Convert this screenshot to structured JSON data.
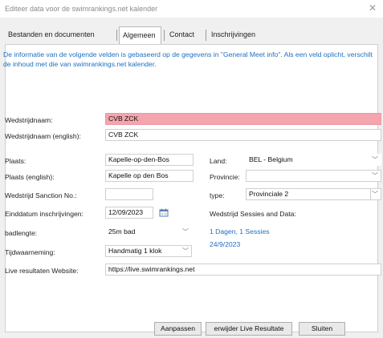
{
  "window": {
    "title": "Editeer data voor de swimrankings.net kalender",
    "close_glyph": "✕"
  },
  "tabs": [
    {
      "label": "Bestanden en documenten",
      "active": false
    },
    {
      "label": "Algemeen",
      "active": true
    },
    {
      "label": "Contact",
      "active": false
    },
    {
      "label": "Inschrijvingen",
      "active": false
    }
  ],
  "info_text": "De informatie van de volgende velden is gebaseerd op de gegevens in \"General Meet info\". Als een veld oplicht, verschilt de inhoud met die van swimrankings.net kalender.",
  "form": {
    "meet_name": {
      "label": "Wedstrijdnaam:",
      "value": "CVB ZCK",
      "highlight_color": "#f4a5ad"
    },
    "meet_name_en": {
      "label": "Wedstrijdnaam (english):",
      "value": "CVB ZCK"
    },
    "city": {
      "label": "Plaats:",
      "value": "Kapelle-op-den-Bos"
    },
    "city_en": {
      "label": "Plaats (english):",
      "value": "Kapelle op den Bos"
    },
    "sanction": {
      "label": "Wedstrijd Sanction No.:",
      "value": ""
    },
    "entry_deadline": {
      "label": "Einddatum inschrijvingen:",
      "value": "12/09/2023"
    },
    "pool_length": {
      "label": "badlengte:",
      "value": "25m bad"
    },
    "timing": {
      "label": "Tijdwaarneming:",
      "value": "Handmatig 1 klok"
    },
    "live_results": {
      "label": "Live resultaten Website:",
      "value": "https://live.swimrankings.net"
    },
    "country": {
      "label": "Land:",
      "value": "BEL - Belgium"
    },
    "province": {
      "label": "Provincie:",
      "value": ""
    },
    "type": {
      "label": "type:",
      "value": "Provinciale 2"
    },
    "sessions": {
      "label": "Wedstrijd Sessies and Data:",
      "summary": "1 Dagen, 1 Sessies",
      "dates": "24/9/2023"
    }
  },
  "buttons": {
    "adjust": "Aanpassen",
    "remove_live": "erwijder Live Resultate",
    "close": "Sluiten"
  },
  "colors": {
    "accent_blue": "#1f6fbf",
    "highlight_pink": "#f4a5ad"
  }
}
